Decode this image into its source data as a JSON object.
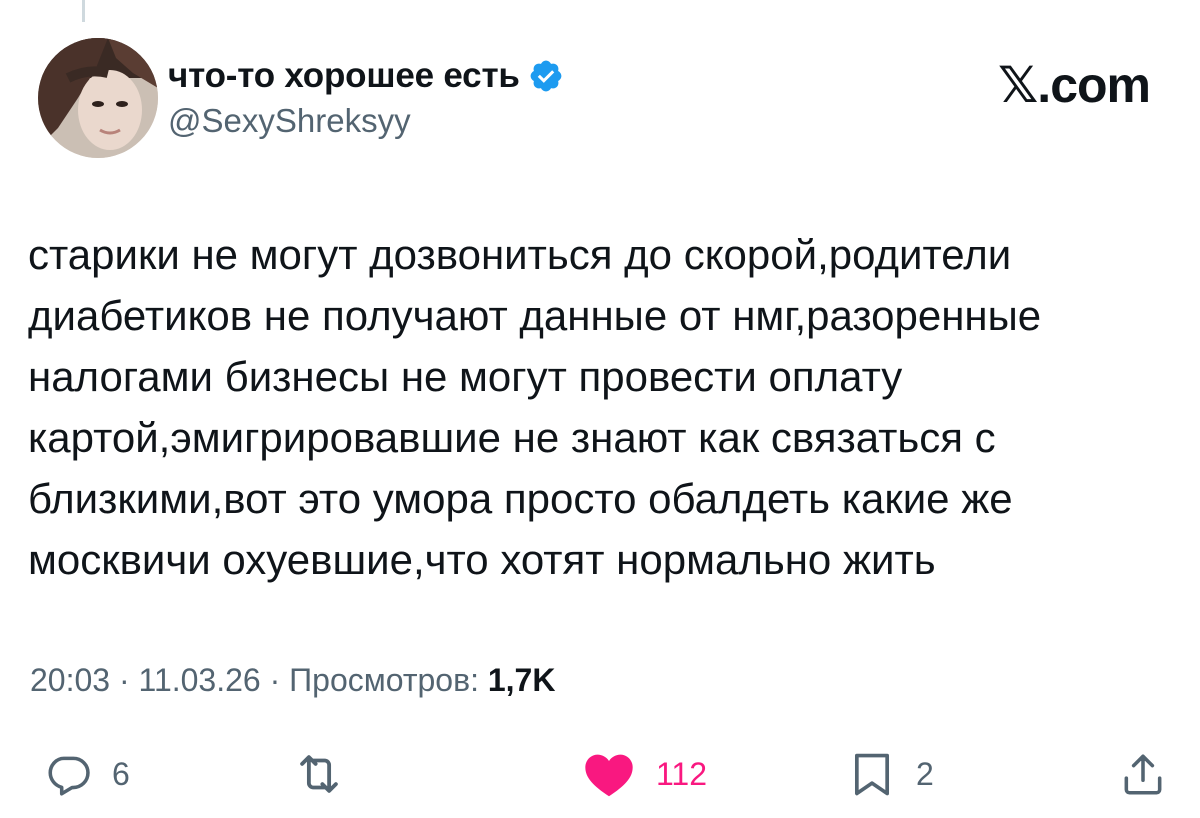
{
  "author": {
    "display_name": "что-то хорошее есть",
    "handle": "@SexyShreksyy",
    "verified_icon": "verified-badge-icon",
    "avatar_icon": "profile-photo"
  },
  "brand": "𝕏.com",
  "tweet": {
    "lines": [
      "старики не могут дозвониться до скорой,родители",
      "диабетиков не получают данные от нмг,разоренные",
      "налогами бизнесы не могут провести оплату",
      "картой,эмигрировавшие не знают как связаться с",
      "близкими,вот это умора просто обалдеть какие же",
      "москвичи охуевшие,что хотят нормально жить"
    ]
  },
  "meta": {
    "time": "20:03",
    "separator": "·",
    "date": "11.03.26",
    "views_label": "Просмотров:",
    "views_count": "1,7K"
  },
  "actions": {
    "reply": {
      "icon": "reply-icon",
      "count": "6"
    },
    "retweet": {
      "icon": "retweet-icon",
      "count": ""
    },
    "like": {
      "icon": "heart-icon",
      "count": "112",
      "active": true
    },
    "bookmark": {
      "icon": "bookmark-icon",
      "count": "2"
    },
    "share": {
      "icon": "share-icon",
      "count": ""
    }
  },
  "colors": {
    "text": "#0f1419",
    "secondary": "#536471",
    "verified_blue": "#1d9bf0",
    "like_pink": "#f91880",
    "thread_line": "#cfd9de"
  }
}
